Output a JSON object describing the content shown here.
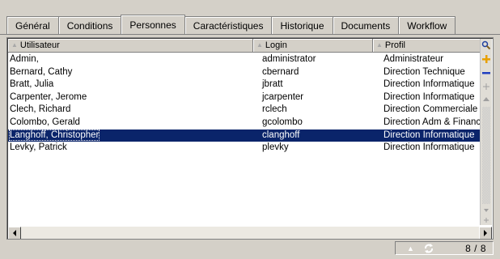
{
  "tabs": [
    {
      "label": "Général",
      "active": false
    },
    {
      "label": "Conditions",
      "active": false
    },
    {
      "label": "Personnes",
      "active": true
    },
    {
      "label": "Caractéristiques",
      "active": false
    },
    {
      "label": "Historique",
      "active": false
    },
    {
      "label": "Documents",
      "active": false
    },
    {
      "label": "Workflow",
      "active": false
    }
  ],
  "grid": {
    "columns": [
      "Utilisateur",
      "Login",
      "Profil"
    ],
    "rows": [
      {
        "user": "Admin,",
        "login": "administrator",
        "profil": "Administrateur",
        "selected": false
      },
      {
        "user": "Bernard, Cathy",
        "login": "cbernard",
        "profil": "Direction Technique",
        "selected": false
      },
      {
        "user": "Bratt, Julia",
        "login": "jbratt",
        "profil": "Direction Informatique",
        "selected": false
      },
      {
        "user": "Carpenter, Jerome",
        "login": "jcarpenter",
        "profil": "Direction Informatique",
        "selected": false
      },
      {
        "user": "Clech, Richard",
        "login": "rclech",
        "profil": "Direction Commerciale",
        "selected": false
      },
      {
        "user": "Colombo, Gerald",
        "login": "gcolombo",
        "profil": "Direction Adm & Financière",
        "selected": false
      },
      {
        "user": "Langhoff, Christopher",
        "login": "clanghoff",
        "profil": "Direction Informatique",
        "selected": true
      },
      {
        "user": "Levky, Patrick",
        "login": "plevky",
        "profil": "Direction Informatique",
        "selected": false
      }
    ]
  },
  "status": {
    "count": "8 / 8"
  },
  "icons": {
    "search": "magnifier-icon",
    "add": "plus-icon",
    "remove": "minus-icon",
    "expand": "expand-icon",
    "collapse": "collapse-icon",
    "refresh": "refresh-icon"
  },
  "colors": {
    "selection": "#0a246a",
    "add": "#e8a000",
    "remove": "#2040c0"
  }
}
